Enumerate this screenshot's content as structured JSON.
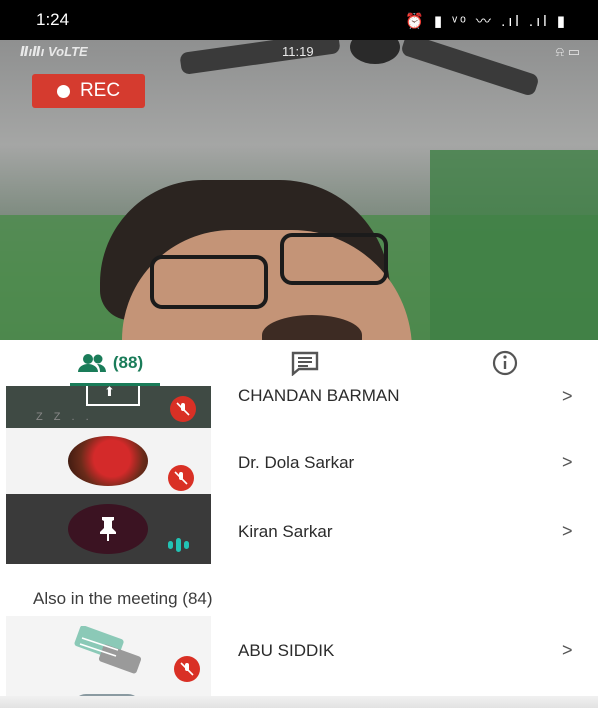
{
  "status_bar": {
    "time": "1:24",
    "icons_text": "⏰ ▮ ᵛᵒ 〰 .ıl .ıl ▮"
  },
  "video": {
    "inner_signal": "ⅡıⅡı VoLTE",
    "inner_time": "11:19",
    "inner_icons": "⍾ ▭",
    "rec_label": "REC"
  },
  "tabs": {
    "people_count": "(88)",
    "people_icon": "people-icon",
    "chat_icon": "chat-icon",
    "info_icon": "info-icon",
    "accent": "#1a7c59"
  },
  "participants": [
    {
      "name": "CHANDAN BARMAN",
      "muted": true
    },
    {
      "name": "Dr. Dola Sarkar",
      "muted": true
    },
    {
      "name": "Kiran Sarkar",
      "muted": false,
      "speaking": true
    }
  ],
  "also_in_meeting": {
    "label": "Also in the meeting (84)",
    "items": [
      {
        "name": "ABU SIDDIK",
        "muted": true
      }
    ]
  },
  "colors": {
    "mute_red": "#d93025",
    "rec_red": "#d53b2f",
    "speaking_teal": "#22c3b4"
  }
}
